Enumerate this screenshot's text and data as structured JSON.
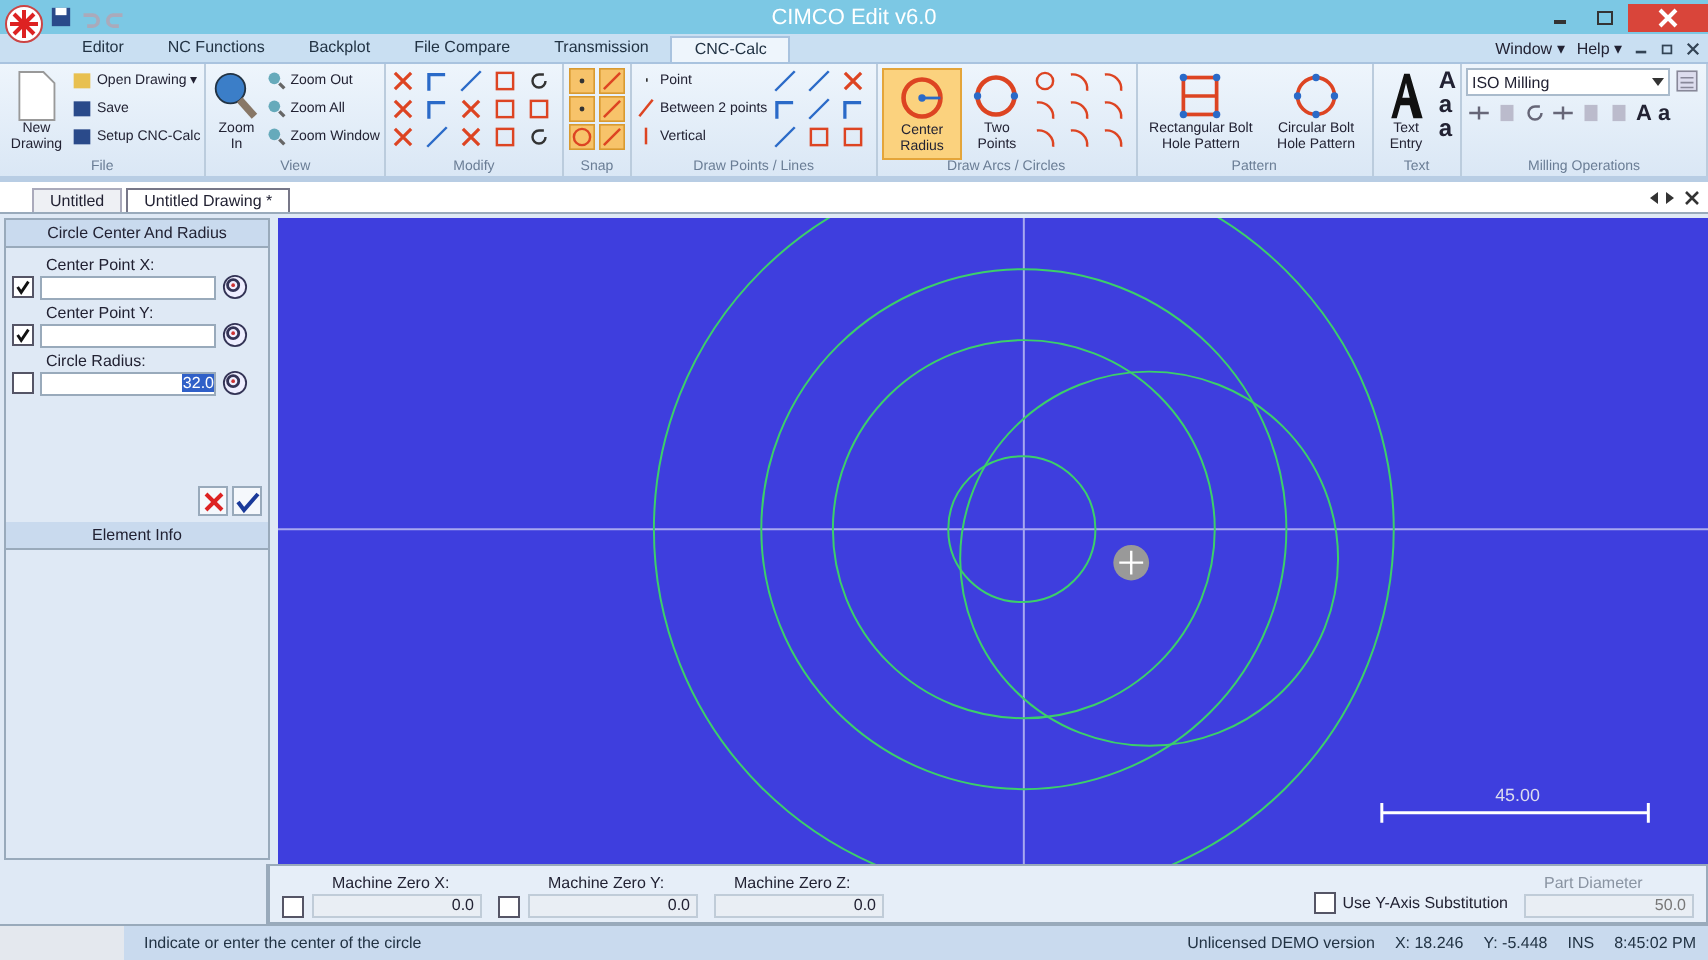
{
  "window": {
    "title": "CIMCO Edit v6.0"
  },
  "menu_tabs": [
    {
      "label": "Editor",
      "selected": false
    },
    {
      "label": "NC Functions",
      "selected": false
    },
    {
      "label": "Backplot",
      "selected": false
    },
    {
      "label": "File Compare",
      "selected": false
    },
    {
      "label": "Transmission",
      "selected": false
    },
    {
      "label": "CNC-Calc",
      "selected": true
    }
  ],
  "menu_right": [
    "Window ▾",
    "Help ▾"
  ],
  "ribbon": [
    {
      "kind": "file",
      "label": "File",
      "large": [
        {
          "label": "New Drawing"
        }
      ],
      "small": [
        {
          "label": "Open Drawing ▾"
        },
        {
          "label": "Save"
        },
        {
          "label": "Setup CNC-Calc"
        }
      ]
    },
    {
      "kind": "view",
      "label": "View",
      "large": [
        {
          "label": "Zoom In"
        }
      ],
      "small": [
        {
          "label": "Zoom Out"
        },
        {
          "label": "Zoom All"
        },
        {
          "label": "Zoom Window"
        }
      ]
    },
    {
      "kind": "modify",
      "label": "Modify"
    },
    {
      "kind": "snap",
      "label": "Snap",
      "toggles": [
        {
          "on": true
        },
        {
          "on": true
        },
        {
          "on": true
        },
        {
          "on": true
        },
        {
          "on": true
        },
        {
          "on": true
        }
      ]
    },
    {
      "kind": "points",
      "label": "Draw Points / Lines",
      "small": [
        {
          "label": "Point"
        },
        {
          "label": "Between 2 points"
        },
        {
          "label": "Vertical"
        }
      ]
    },
    {
      "kind": "arcs",
      "label": "Draw Arcs / Circles",
      "large": [
        {
          "label": "Center Radius",
          "selected": true
        },
        {
          "label": "Two Points",
          "selected": false
        }
      ]
    },
    {
      "kind": "pattern",
      "label": "Pattern",
      "large": [
        {
          "label": "Rectangular Bolt Hole Pattern"
        },
        {
          "label": "Circular Bolt Hole Pattern"
        }
      ]
    },
    {
      "kind": "text",
      "label": "Text",
      "large": [
        {
          "label": "Text Entry"
        }
      ],
      "glyphs": [
        "A",
        "a",
        "a"
      ]
    },
    {
      "kind": "milling",
      "label": "Milling Operations",
      "combo": "ISO Milling",
      "glyphs": [
        "A",
        "a"
      ]
    }
  ],
  "doc_tabs": [
    {
      "label": "Untitled",
      "selected": false
    },
    {
      "label": "Untitled Drawing *",
      "selected": true
    }
  ],
  "panel": {
    "title": "Circle Center And Radius",
    "fields": [
      {
        "label": "Center Point X:",
        "checked": true
      },
      {
        "label": "Center Point Y:",
        "checked": true
      },
      {
        "label": "Circle Radius:",
        "checked": false,
        "value": "32.0",
        "selected": true
      }
    ],
    "info_title": "Element Info"
  },
  "canvas": {
    "scale_label": "45.00"
  },
  "bottom": {
    "fields": [
      {
        "label": "Machine Zero X:",
        "value": "0.0",
        "kind": "check",
        "checked": false
      },
      {
        "label": "Machine Zero Y:",
        "value": "0.0",
        "kind": "check",
        "checked": false
      },
      {
        "label": "Machine Zero Z:",
        "value": "0.0",
        "kind": "plain"
      }
    ],
    "substitution": {
      "label": "Use Y-Axis Substitution",
      "checked": false
    },
    "part_diameter": {
      "label": "Part Diameter",
      "value": "50.0",
      "disabled": true
    }
  },
  "status_bar": {
    "message": "Indicate or enter the center of the circle",
    "license": "Unlicensed DEMO version",
    "x": "X: 18.246",
    "y": "Y: -5.448",
    "mode": "INS",
    "time": "8:45:02 PM"
  }
}
